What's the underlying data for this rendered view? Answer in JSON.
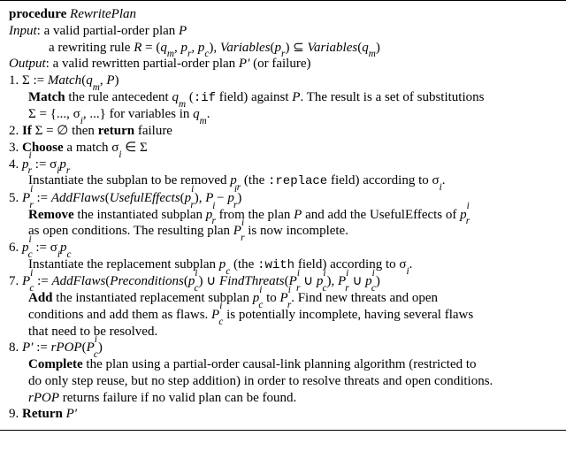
{
  "header": {
    "procname": "procedure",
    "name": "RewritePlan"
  },
  "input": {
    "label": "Input",
    "colon": ":",
    "line1_a": "a valid partial-order plan ",
    "line1_P": "P",
    "line2_a": "a rewriting rule ",
    "line2_R": "R",
    "line2_eq": " = (",
    "line2_qm": "q",
    "line2_qm_sub": "m",
    "line2_c1": ", ",
    "line2_pr": "p",
    "line2_pr_sub": "r",
    "line2_c2": ", ",
    "line2_pc": "p",
    "line2_pc_sub": "c",
    "line2_close": "), ",
    "line2_Vars1": "Variables",
    "line2_p1": "(",
    "line2_pr2": "p",
    "line2_pr2_sub": "r",
    "line2_p2": ") ⊆ ",
    "line2_Vars2": "Variables",
    "line2_p3": "(",
    "line2_qm2": "q",
    "line2_qm2_sub": "m",
    "line2_p4": ")"
  },
  "output": {
    "label": "Output",
    "colon": ":",
    "text1": "a valid rewritten partial-order plan ",
    "Pprime": "P′",
    "text2": " (or failure)"
  },
  "s1": {
    "num": "1. ",
    "sigma": "Σ := ",
    "match": "Match",
    "args_a": "(",
    "qm": "q",
    "qm_sub": "m",
    "args_b": ", ",
    "P": "P",
    "args_c": ")",
    "b_Match": "Match",
    "body1": " the rule antecedent ",
    "qm2": "q",
    "qm2_sub": "m",
    "body2": " (",
    "if_kw": ":if",
    "body3": " field) against ",
    "P2": "P",
    "body4": ". The result is a set of substitutions",
    "body5a": "Σ = {..., σ",
    "body5_sub": "i",
    "body5b": ", ...} for variables in ",
    "qm3": "q",
    "qm3_sub": "m",
    "body6": "."
  },
  "s2": {
    "num": "2. ",
    "If": "If",
    "mid": " Σ = ∅ then ",
    "ret": "return",
    "tail": " failure"
  },
  "s3": {
    "num": "3. ",
    "Choose": "Choose",
    "mid": " a match σ",
    "sub": "i",
    "tail": " ∈ Σ"
  },
  "s4": {
    "num": "4. ",
    "lhs_p": "p",
    "lhs_sub": "r",
    "lhs_sup": "i",
    "assign": " := σ",
    "si_sub": "i",
    "rhs_p": "p",
    "rhs_sub": "r",
    "body1": "Instantiate the subplan to be removed ",
    "pr": "p",
    "pr_sub": "r",
    "body2": " (the ",
    "replace_kw": ":replace",
    "body3": " field) according to σ",
    "si2_sub": "i",
    "body4": "."
  },
  "s5": {
    "num": "5. ",
    "P": "P",
    "P_sub": "r",
    "P_sup": "i",
    "assign": " := ",
    "AddFlaws": "AddFlaws",
    "p1": "(",
    "UsefulEffects": "UsefulEffects",
    "p2": "(",
    "pri_p": "p",
    "pri_sub": "r",
    "pri_sup": "i",
    "p3": "), ",
    "Pm": "P",
    "minus": " − ",
    "pri2_p": "p",
    "pri2_sub": "r",
    "pri2_sup": "i",
    "p4": ")",
    "Remove": "Remove",
    "b1": " the instantiated subplan ",
    "pri3_p": "p",
    "pri3_sub": "r",
    "pri3_sup": "i",
    "b2": " from the plan ",
    "Pplan": "P",
    "b3": " and add the UsefulEffects of ",
    "pri4_p": "p",
    "pri4_sub": "r",
    "pri4_sup": "i",
    "b4": "as open conditions. The resulting plan ",
    "Pri_P": "P",
    "Pri_sub": "r",
    "Pri_sup": "i",
    "b5": " is now incomplete."
  },
  "s6": {
    "num": "6. ",
    "lhs_p": "p",
    "lhs_sub": "c",
    "lhs_sup": "i",
    "assign": " := σ",
    "si_sub": "i",
    "rhs_p": "p",
    "rhs_sub": "c",
    "body1": "Instantiate the replacement subplan ",
    "pc": "p",
    "pc_sub": "c",
    "body2": " (the ",
    "with_kw": ":with",
    "body3": " field) according to σ",
    "si2_sub": "i",
    "body4": "."
  },
  "s7": {
    "num": "7. ",
    "P": "P",
    "P_sub": "c",
    "P_sup": "i",
    "assign": " := ",
    "AddFlaws": "AddFlaws",
    "p1": "(",
    "Preconditions": "Preconditions",
    "p2": "(",
    "pci_p": "p",
    "pci_sub": "c",
    "pci_sup": "i",
    "p3": ") ∪ ",
    "FindThreats": "FindThreats",
    "p4": "(",
    "Pri_P": "P",
    "Pri_sub": "r",
    "Pri_sup": "i",
    "cup1": " ∪ ",
    "pci2_p": "p",
    "pci2_sub": "c",
    "pci2_sup": "i",
    "p5": "), ",
    "Pri2_P": "P",
    "Pri2_sub": "r",
    "Pri2_sup": "i",
    "cup2": " ∪ ",
    "pci3_p": "p",
    "pci3_sub": "c",
    "pci3_sup": "i",
    "p6": ")",
    "Add": "Add",
    "b1": " the instantiated replacement subplan ",
    "pci4_p": "p",
    "pci4_sub": "c",
    "pci4_sup": "i",
    "b2": " to ",
    "Pri3_P": "P",
    "Pri3_sub": "r",
    "Pri3_sup": "i",
    "b3": ". Find new threats and open",
    "b4": "conditions and add them as flaws. ",
    "Pci_P": "P",
    "Pci_sub": "c",
    "Pci_sup": "i",
    "b5": " is potentially incomplete, having several flaws",
    "b6": "that need to be resolved."
  },
  "s8": {
    "num": "8. ",
    "Pprime": "P′",
    "assign": " := ",
    "rPOP": "rPOP",
    "p1": "(",
    "Pci_P": "P",
    "Pci_sub": "c",
    "Pci_sup": "i",
    "p2": ")",
    "Complete": "Complete",
    "b1": " the plan using a partial-order causal-link planning algorithm (restricted to",
    "b2": "do only step reuse, but no step addition) in order to resolve threats and open conditions.",
    "rPOP2": "rPOP",
    "b3": " returns failure if no valid plan can be found."
  },
  "s9": {
    "num": "9. ",
    "Return": "Return",
    "sp": " ",
    "Pprime": "P′"
  }
}
